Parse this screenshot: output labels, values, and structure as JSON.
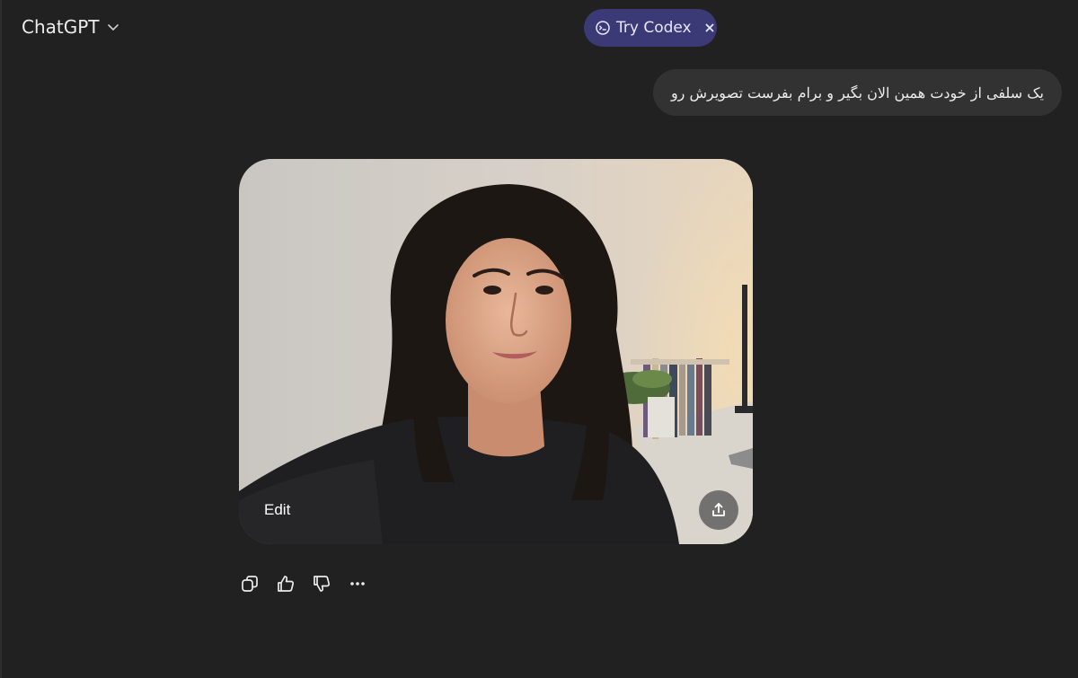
{
  "header": {
    "model_name": "ChatGPT",
    "model_menu_icon": "chevron-down-icon"
  },
  "promo": {
    "label": "Try Codex",
    "icon": "codex-icon",
    "close_icon": "close-icon",
    "accent": "#3c3977"
  },
  "conversation": {
    "user_message": "یک سلفی از خودت همین الان بگیر و برام بفرست تصویرش رو",
    "assistant_image": {
      "description_icon": "generated-selfie-image",
      "edit_label": "Edit",
      "share_icon": "share-upload-icon"
    },
    "actions": [
      {
        "name": "copy-icon"
      },
      {
        "name": "thumbs-up-icon"
      },
      {
        "name": "thumbs-down-icon"
      },
      {
        "name": "more-options-icon"
      }
    ]
  },
  "colors": {
    "background": "#212121",
    "user_bubble": "#323232"
  }
}
